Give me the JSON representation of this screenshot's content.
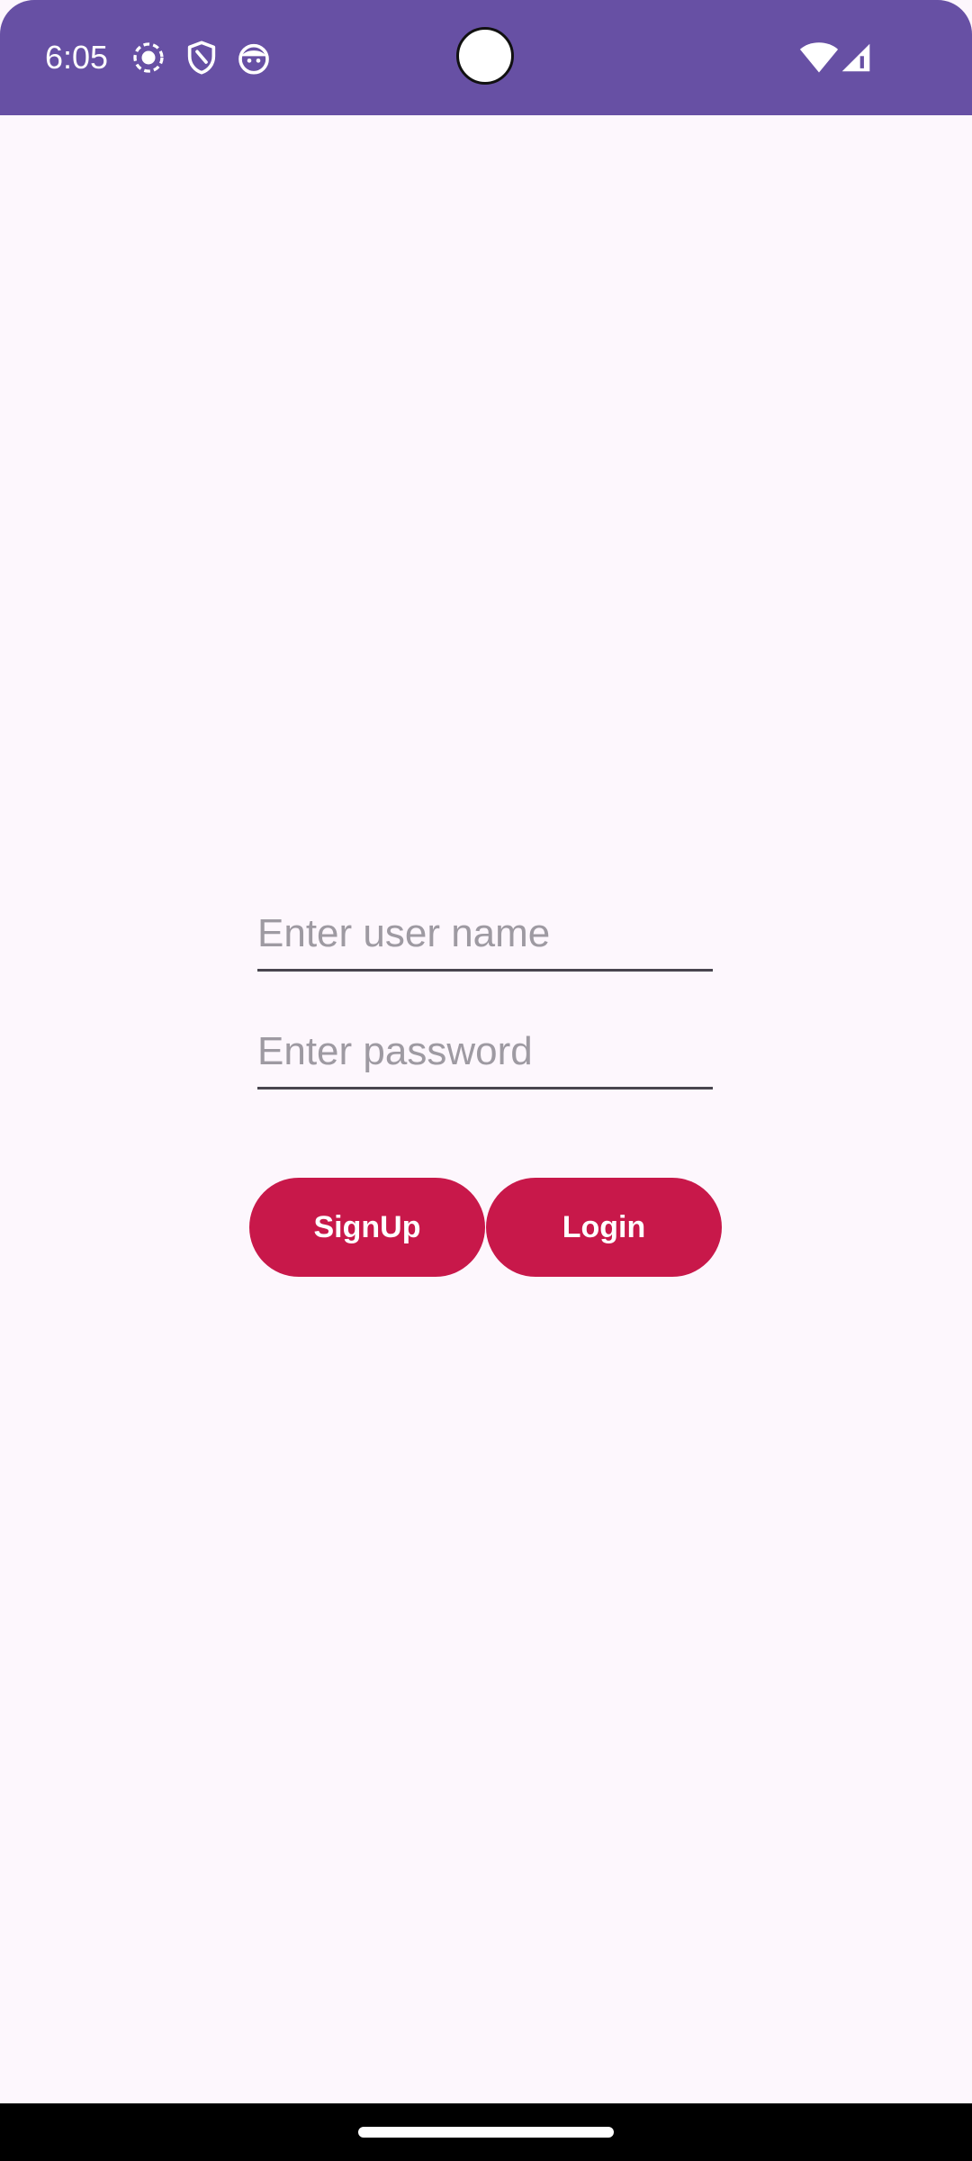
{
  "status_bar": {
    "time": "6:05",
    "icons": [
      "screen-record-icon",
      "shield-icon",
      "android-face-icon"
    ],
    "right_icons": [
      "wifi-icon",
      "signal-icon"
    ],
    "background": "#6750a4"
  },
  "form": {
    "username": {
      "value": "",
      "placeholder": "Enter user name"
    },
    "password": {
      "value": "",
      "placeholder": "Enter password"
    }
  },
  "buttons": {
    "signup_label": "SignUp",
    "login_label": "Login",
    "color": "#c8184a"
  },
  "theme": {
    "background": "#fdf7fd"
  }
}
